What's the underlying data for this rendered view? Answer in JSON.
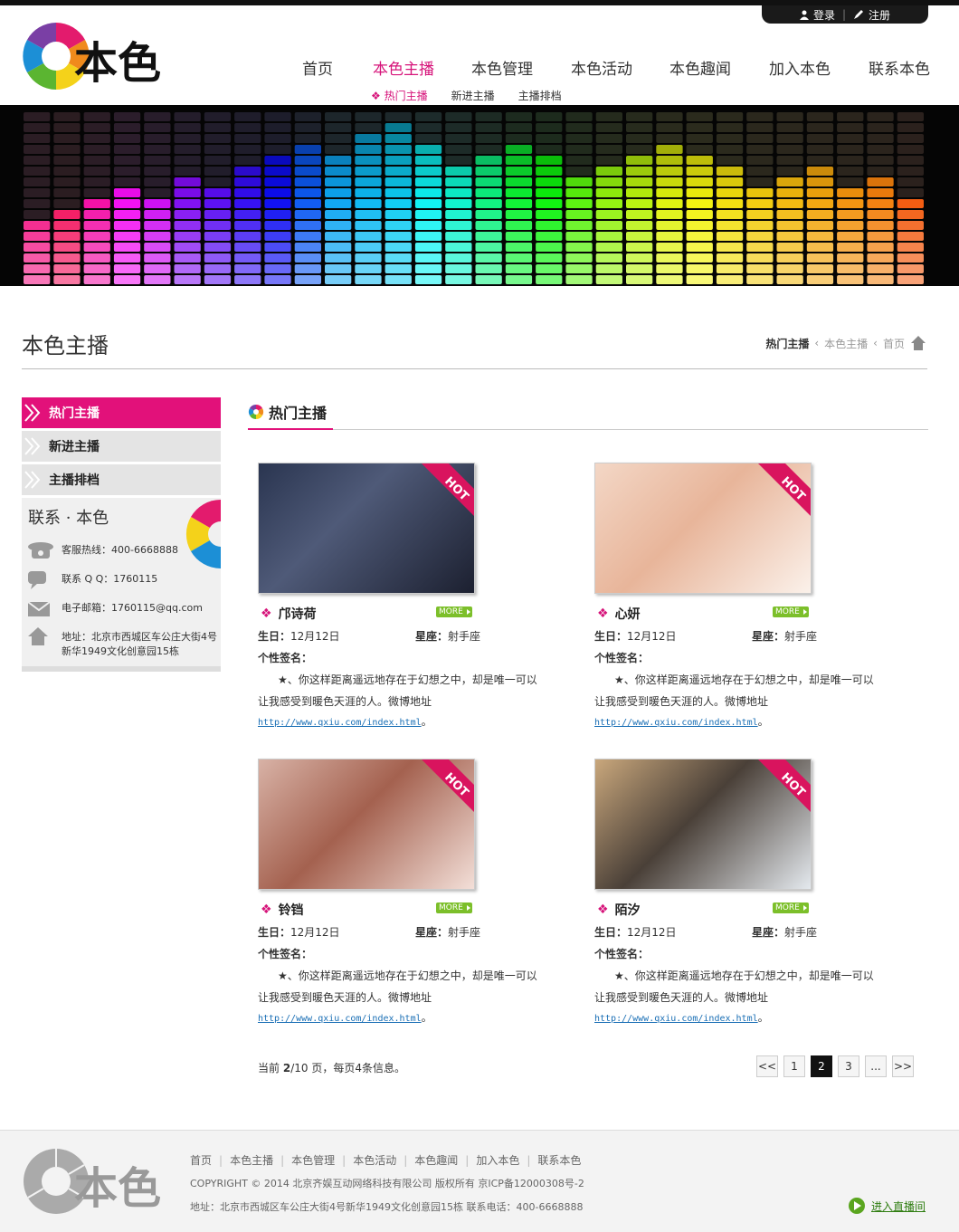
{
  "header": {
    "login": "登录",
    "register": "注册",
    "nav": [
      "首页",
      "本色主播",
      "本色管理",
      "本色活动",
      "本色趣闻",
      "加入本色",
      "联系本色"
    ],
    "subnav": [
      "热门主播",
      "新进主播",
      "主播排档"
    ]
  },
  "page": {
    "title": "本色主播",
    "breadcrumb": [
      "热门主播",
      "本色主播",
      "首页"
    ]
  },
  "sidebar": {
    "menu": [
      "热门主播",
      "新进主播",
      "主播排档"
    ],
    "contact_title": "联系 · 本色",
    "hotline": "客服热线：400-6668888",
    "qq": "联系 Q Q：1760115",
    "email": "电子邮箱：1760115@qq.com",
    "address": "地址：北京市西城区车公庄大街4号新华1949文化创意园15栋"
  },
  "content": {
    "title": "热门主播",
    "more": "MORE",
    "hot": "HOT",
    "birthday_label": "生日：",
    "sign_label": "星座：",
    "signature_label": "个性签名：",
    "link": "http://www.qxiu.com/index.html",
    "streamers": [
      {
        "name": "邝诗荷",
        "birthday": "12月12日",
        "sign": "射手座",
        "quote": "★、你这样距离遥远地存在于幻想之中，却是唯一可以",
        "quote2": "让我感受到暖色天涯的人。微博地址"
      },
      {
        "name": "心妍",
        "birthday": "12月12日",
        "sign": "射手座",
        "quote": "★、你这样距离遥远地存在于幻想之中，却是唯一可以",
        "quote2": "让我感受到暖色天涯的人。微博地址"
      },
      {
        "name": "铃铛",
        "birthday": "12月12日",
        "sign": "射手座",
        "quote": "★、你这样距离遥远地存在于幻想之中，却是唯一可以",
        "quote2": "让我感受到暖色天涯的人。微博地址"
      },
      {
        "name": "陌汐",
        "birthday": "12月12日",
        "sign": "射手座",
        "quote": "★、你这样距离遥远地存在于幻想之中，却是唯一可以",
        "quote2": "让我感受到暖色天涯的人。微博地址"
      }
    ]
  },
  "pager": {
    "info_prefix": "当前 ",
    "current": "2",
    "info_suffix": "/10 页，每页4条信息。",
    "pages": [
      "1",
      "2",
      "3",
      "..."
    ],
    "prev": "<<",
    "next": ">>"
  },
  "footer": {
    "links": [
      "首页",
      "本色主播",
      "本色管理",
      "本色活动",
      "本色趣闻",
      "加入本色",
      "联系本色"
    ],
    "copyright": "COPYRIGHT © 2014 北京齐娱互动网络科技有限公司 版权所有  京ICP备12000308号-2",
    "address": "地址：北京市西城区车公庄大街4号新华1949文化创意园15栋   联系电话：400-6668888",
    "live": "进入直播间"
  },
  "colors": {
    "accent": "#e2117a",
    "more": "#7cbf2a",
    "link": "#1a6fb5"
  }
}
